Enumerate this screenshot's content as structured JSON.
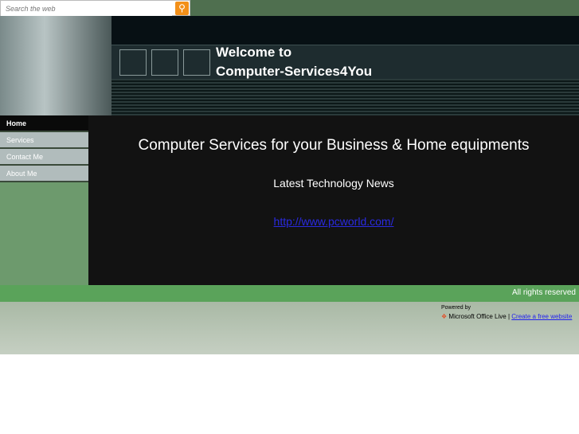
{
  "search": {
    "placeholder": "Search the web"
  },
  "header": {
    "title_line1": "Welcome to",
    "title_line2": "Computer-Services4You"
  },
  "nav": {
    "items": [
      {
        "label": "Home"
      },
      {
        "label": "Services"
      },
      {
        "label": "Contact Me"
      },
      {
        "label": "About Me"
      }
    ]
  },
  "main": {
    "heading": "Computer Services for your Business & Home equipments",
    "subheading": "Latest Technology News",
    "link": "http://www.pcworld.com/"
  },
  "footer": {
    "rights": "All rights reserved",
    "powered_by": "Powered by",
    "office_live": "Microsoft Office Live",
    "separator": "|",
    "create_link": "Create a free website"
  }
}
